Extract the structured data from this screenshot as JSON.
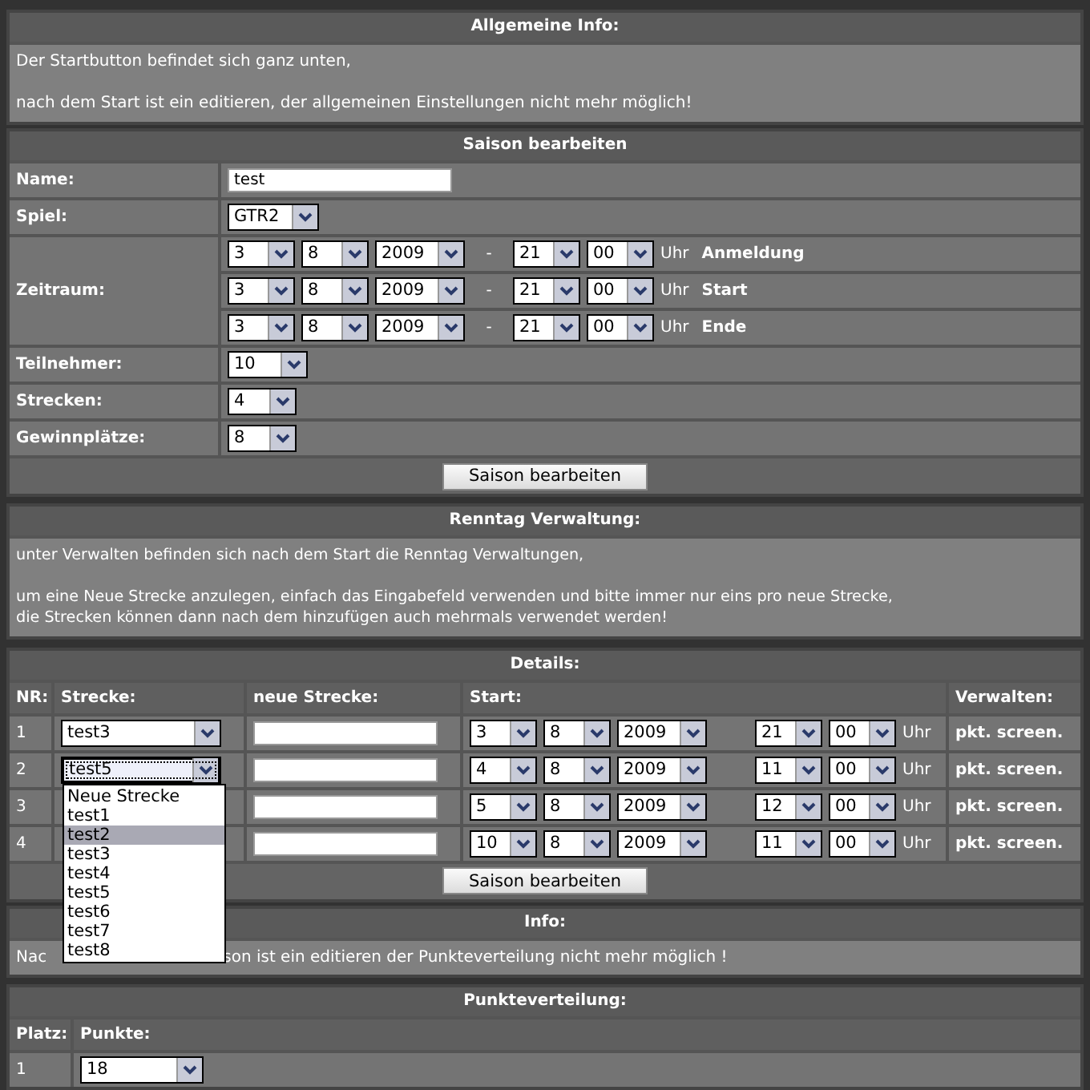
{
  "general_info": {
    "title": "Allgemeine Info:",
    "lines": [
      "Der Startbutton befindet sich ganz unten,",
      "nach dem Start ist ein editieren, der allgemeinen Einstellungen nicht mehr möglich!"
    ]
  },
  "season": {
    "title": "Saison bearbeiten",
    "rows": [
      {
        "kind": "text",
        "label": "Name:",
        "value": "test"
      },
      {
        "kind": "select",
        "label": "Spiel:",
        "value": "GTR2"
      },
      {
        "kind": "period",
        "label": "Zeitraum:",
        "entries": [
          {
            "day": "3",
            "month": "8",
            "year": "2009",
            "separator": "-",
            "hour": "21",
            "minute": "00",
            "unit": "Uhr",
            "name": "Anmeldung"
          },
          {
            "day": "3",
            "month": "8",
            "year": "2009",
            "separator": "-",
            "hour": "21",
            "minute": "00",
            "unit": "Uhr",
            "name": "Start"
          },
          {
            "day": "3",
            "month": "8",
            "year": "2009",
            "separator": "-",
            "hour": "21",
            "minute": "00",
            "unit": "Uhr",
            "name": "Ende"
          }
        ]
      },
      {
        "kind": "select",
        "label": "Teilnehmer:",
        "value": "10"
      },
      {
        "kind": "select",
        "label": "Strecken:",
        "value": "4"
      },
      {
        "kind": "select",
        "label": "Gewinnplätze:",
        "value": "8"
      }
    ],
    "button": "Saison bearbeiten"
  },
  "raceday": {
    "title": "Renntag Verwaltung:",
    "paragraphs": [
      [
        "unter Verwalten befinden sich nach dem Start die Renntag Verwaltungen,"
      ],
      [
        "um eine Neue Strecke anzulegen, einfach das Eingabefeld verwenden und bitte immer nur eins pro neue Strecke,",
        "die Strecken können dann nach dem hinzufügen auch mehrmals verwendet werden!"
      ]
    ]
  },
  "details": {
    "title": "Details:",
    "columns": [
      "NR:",
      "Strecke:",
      "neue Strecke:",
      "Start:",
      "Verwalten:"
    ],
    "rows": [
      {
        "nr": "1",
        "track": {
          "value": "test3",
          "focused": false,
          "expanded": false
        },
        "start": {
          "day": "3",
          "month": "8",
          "year": "2009",
          "hour": "21",
          "minute": "00",
          "unit": "Uhr"
        },
        "manage": "pkt. screen."
      },
      {
        "nr": "2",
        "track": {
          "value": "test5",
          "focused": true,
          "expanded": true,
          "options": [
            {
              "label": "Neue Strecke",
              "highlighted": false
            },
            {
              "label": "test1",
              "highlighted": false
            },
            {
              "label": "test2",
              "highlighted": true
            },
            {
              "label": "test3",
              "highlighted": false
            },
            {
              "label": "test4",
              "highlighted": false
            },
            {
              "label": "test5",
              "highlighted": false
            },
            {
              "label": "test6",
              "highlighted": false
            },
            {
              "label": "test7",
              "highlighted": false
            },
            {
              "label": "test8",
              "highlighted": false
            }
          ]
        },
        "start": {
          "day": "4",
          "month": "8",
          "year": "2009",
          "hour": "11",
          "minute": "00",
          "unit": "Uhr"
        },
        "manage": "pkt. screen."
      },
      {
        "nr": "3",
        "start": {
          "day": "5",
          "month": "8",
          "year": "2009",
          "hour": "12",
          "minute": "00",
          "unit": "Uhr"
        },
        "manage": "pkt. screen."
      },
      {
        "nr": "4",
        "start": {
          "day": "10",
          "month": "8",
          "year": "2009",
          "hour": "11",
          "minute": "00",
          "unit": "Uhr"
        },
        "manage": "pkt. screen."
      }
    ],
    "button": "Saison bearbeiten"
  },
  "info": {
    "title": "Info:",
    "text_parts": [
      "Nac",
      "son ist ein editieren der Punkteverteilung nicht mehr möglich !"
    ]
  },
  "points": {
    "title": "Punkteverteilung:",
    "columns": [
      "Platz:",
      "Punkte:"
    ],
    "rows": [
      {
        "place": "1",
        "points": "18"
      }
    ]
  }
}
